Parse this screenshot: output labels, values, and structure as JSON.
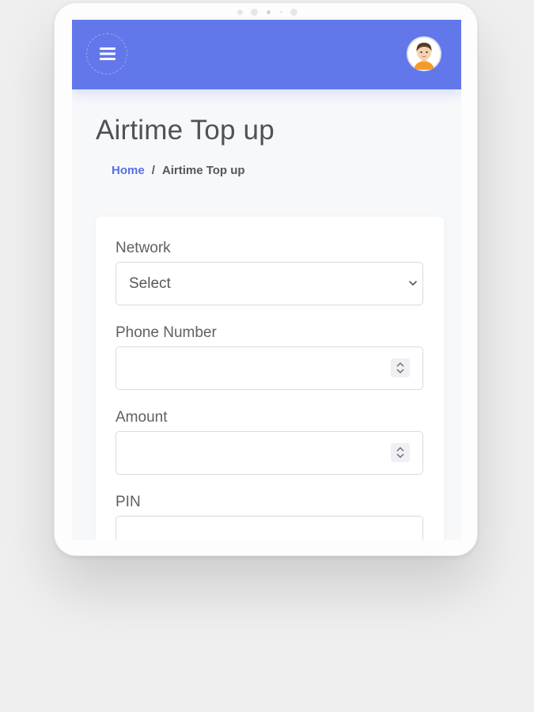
{
  "header": {
    "menu_icon": "hamburger-menu-icon",
    "avatar_icon": "user-avatar-icon",
    "brand_color": "#6277ea"
  },
  "page": {
    "title": "Airtime Top up",
    "breadcrumb": {
      "home": "Home",
      "separator": "/",
      "current": "Airtime Top up"
    }
  },
  "form": {
    "network": {
      "label": "Network",
      "value": "Select"
    },
    "phone": {
      "label": "Phone Number",
      "value": ""
    },
    "amount": {
      "label": "Amount",
      "value": ""
    },
    "pin": {
      "label": "PIN",
      "value": ""
    }
  }
}
